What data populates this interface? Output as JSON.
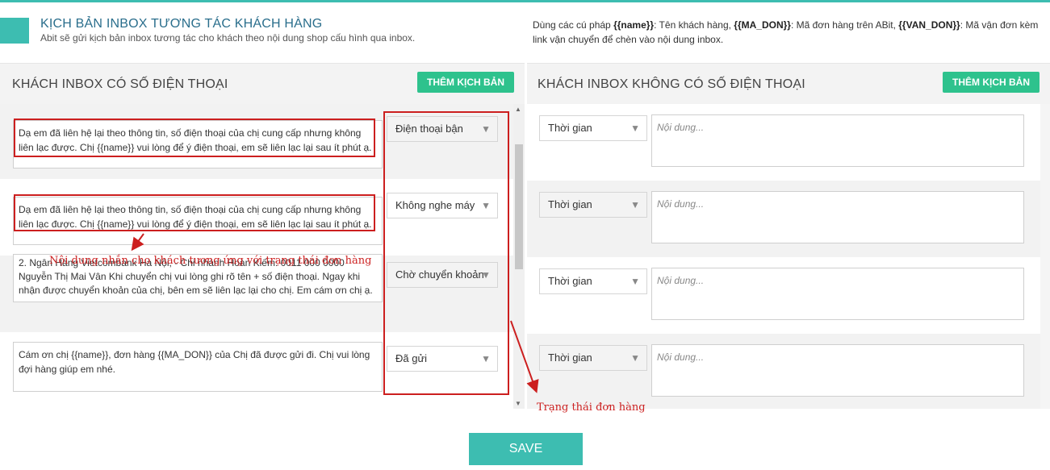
{
  "header": {
    "title": "KỊCH BẢN INBOX TƯƠNG TÁC KHÁCH HÀNG",
    "subtitle": "Abit sẽ gửi kịch bản inbox tương tác cho khách theo nội dung shop cấu hình qua inbox.",
    "hint_prefix": "Dùng các cú pháp ",
    "hint_name_token": "{{name}}",
    "hint_name_desc": ": Tên khách hàng, ",
    "hint_madon_token": "{{MA_DON}}",
    "hint_madon_desc": ": Mã đơn hàng trên ABit, ",
    "hint_vandon_token": "{{VAN_DON}}",
    "hint_vandon_desc": ": Mã vận đơn kèm link vận chuyển để chèn vào nội dung inbox."
  },
  "left_panel": {
    "title": "KHÁCH INBOX CÓ SỐ ĐIỆN THOẠI",
    "add_label": "THÊM KỊCH BẢN",
    "rows": [
      {
        "message": "Dạ em đã liên hệ lại theo thông tin, số điện thoại của chị cung cấp nhưng không liên lạc được. Chị {{name}} vui lòng để ý điện thoại, em sẽ liên lạc lại sau ít phút ạ.",
        "status": "Điện thoại bận"
      },
      {
        "message": "Dạ em đã liên hệ lại theo thông tin, số điện thoại của chị cung cấp nhưng không liên lạc được. Chị {{name}} vui lòng để ý điện thoại, em sẽ liên lạc lại sau ít phút ạ.",
        "status": "Không nghe máy"
      },
      {
        "message": "2. Ngân Hàng Vietcombank Hà Nội, - Chi nhánh Hoàn Kiếm: 0011 000 0000 Nguyễn Thị Mai Vân\nKhi chuyển chị vui lòng ghi rõ tên + số điện thoại. Ngay khi nhận được chuyển khoản của chị, bên em sẽ liên lạc lại cho chị. Em cám ơn chị ạ.",
        "status": "Chờ chuyển khoản"
      },
      {
        "message": "Cám ơn chị {{name}}, đơn hàng {{MA_DON}} của Chị đã được gửi đi. Chị vui lòng đợi hàng giúp em nhé.",
        "status": "Đã gửi"
      }
    ]
  },
  "right_panel": {
    "title": "KHÁCH INBOX KHÔNG CÓ SỐ ĐIỆN THOẠI",
    "add_label": "THÊM KỊCH BẢN",
    "rows": [
      {
        "time_label": "Thời gian",
        "content_placeholder": "Nội dung..."
      },
      {
        "time_label": "Thời gian",
        "content_placeholder": "Nội dung..."
      },
      {
        "time_label": "Thời gian",
        "content_placeholder": "Nội dung..."
      },
      {
        "time_label": "Thời gian",
        "content_placeholder": "Nội dung..."
      }
    ]
  },
  "annotations": {
    "message_note": "Nội dung nhắn cho khách tương ứng với trạng thái đơn hàng",
    "status_note": "Trạng thái đơn hàng"
  },
  "save_label": "SAVE",
  "icons": {
    "dropdown": "chevron-down-icon",
    "resize": "resize-grip-icon"
  },
  "colors": {
    "accent": "#3dbdb1",
    "add_button": "#2ec28d",
    "annotation": "#cc1f1f"
  }
}
